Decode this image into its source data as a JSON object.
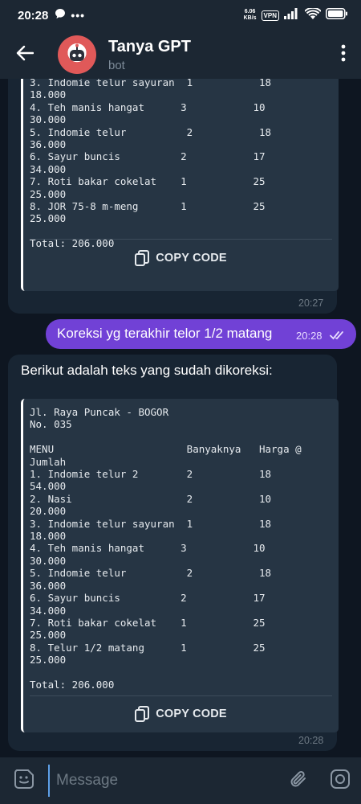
{
  "status_bar": {
    "time": "20:28",
    "speed_value": "6.06",
    "speed_unit": "KB/s",
    "vpn": "VPN"
  },
  "header": {
    "title": "Tanya GPT",
    "subtitle": "bot"
  },
  "messages": {
    "first": {
      "code": "3. Indomie telur sayuran  1           18\n18.000\n4. Teh manis hangat      3           10\n30.000\n5. Indomie telur          2           18\n36.000\n6. Sayur buncis          2           17\n34.000\n7. Roti bakar cokelat    1           25\n25.000\n8. JOR 75-8 m-meng       1           25\n25.000\n\nTotal: 206.000",
      "copy_label": "COPY CODE",
      "time": "20:27"
    },
    "outgoing": {
      "text": "Koreksi yg terakhir telor 1/2 matang",
      "time": "20:28"
    },
    "reply": {
      "text": "Berikut adalah teks yang sudah dikoreksi:",
      "code": "Jl. Raya Puncak - BOGOR\nNo. 035\n\nMENU                      Banyaknya   Harga @\nJumlah\n1. Indomie telur 2        2           18\n54.000\n2. Nasi                   2           10\n20.000\n3. Indomie telur sayuran  1           18\n18.000\n4. Teh manis hangat      3           10\n30.000\n5. Indomie telur          2           18\n36.000\n6. Sayur buncis          2           17\n34.000\n7. Roti bakar cokelat    1           25\n25.000\n8. Telur 1/2 matang      1           25\n25.000\n\nTotal: 206.000",
      "copy_label": "COPY CODE",
      "time": "20:28"
    }
  },
  "input": {
    "placeholder": "Message"
  },
  "colors": {
    "background": "#0e1621",
    "header": "#1c2733",
    "incoming_bubble": "#182533",
    "code_block": "#263544",
    "outgoing_bubble": "#7141d6",
    "cursor": "#5ea0e8"
  },
  "icons": {
    "back": "arrow-left-icon",
    "menu": "more-vertical-icon",
    "copy": "copy-icon",
    "read": "double-check-icon",
    "emoji": "sticker-icon",
    "attach": "paperclip-icon",
    "camera": "camera-icon"
  }
}
